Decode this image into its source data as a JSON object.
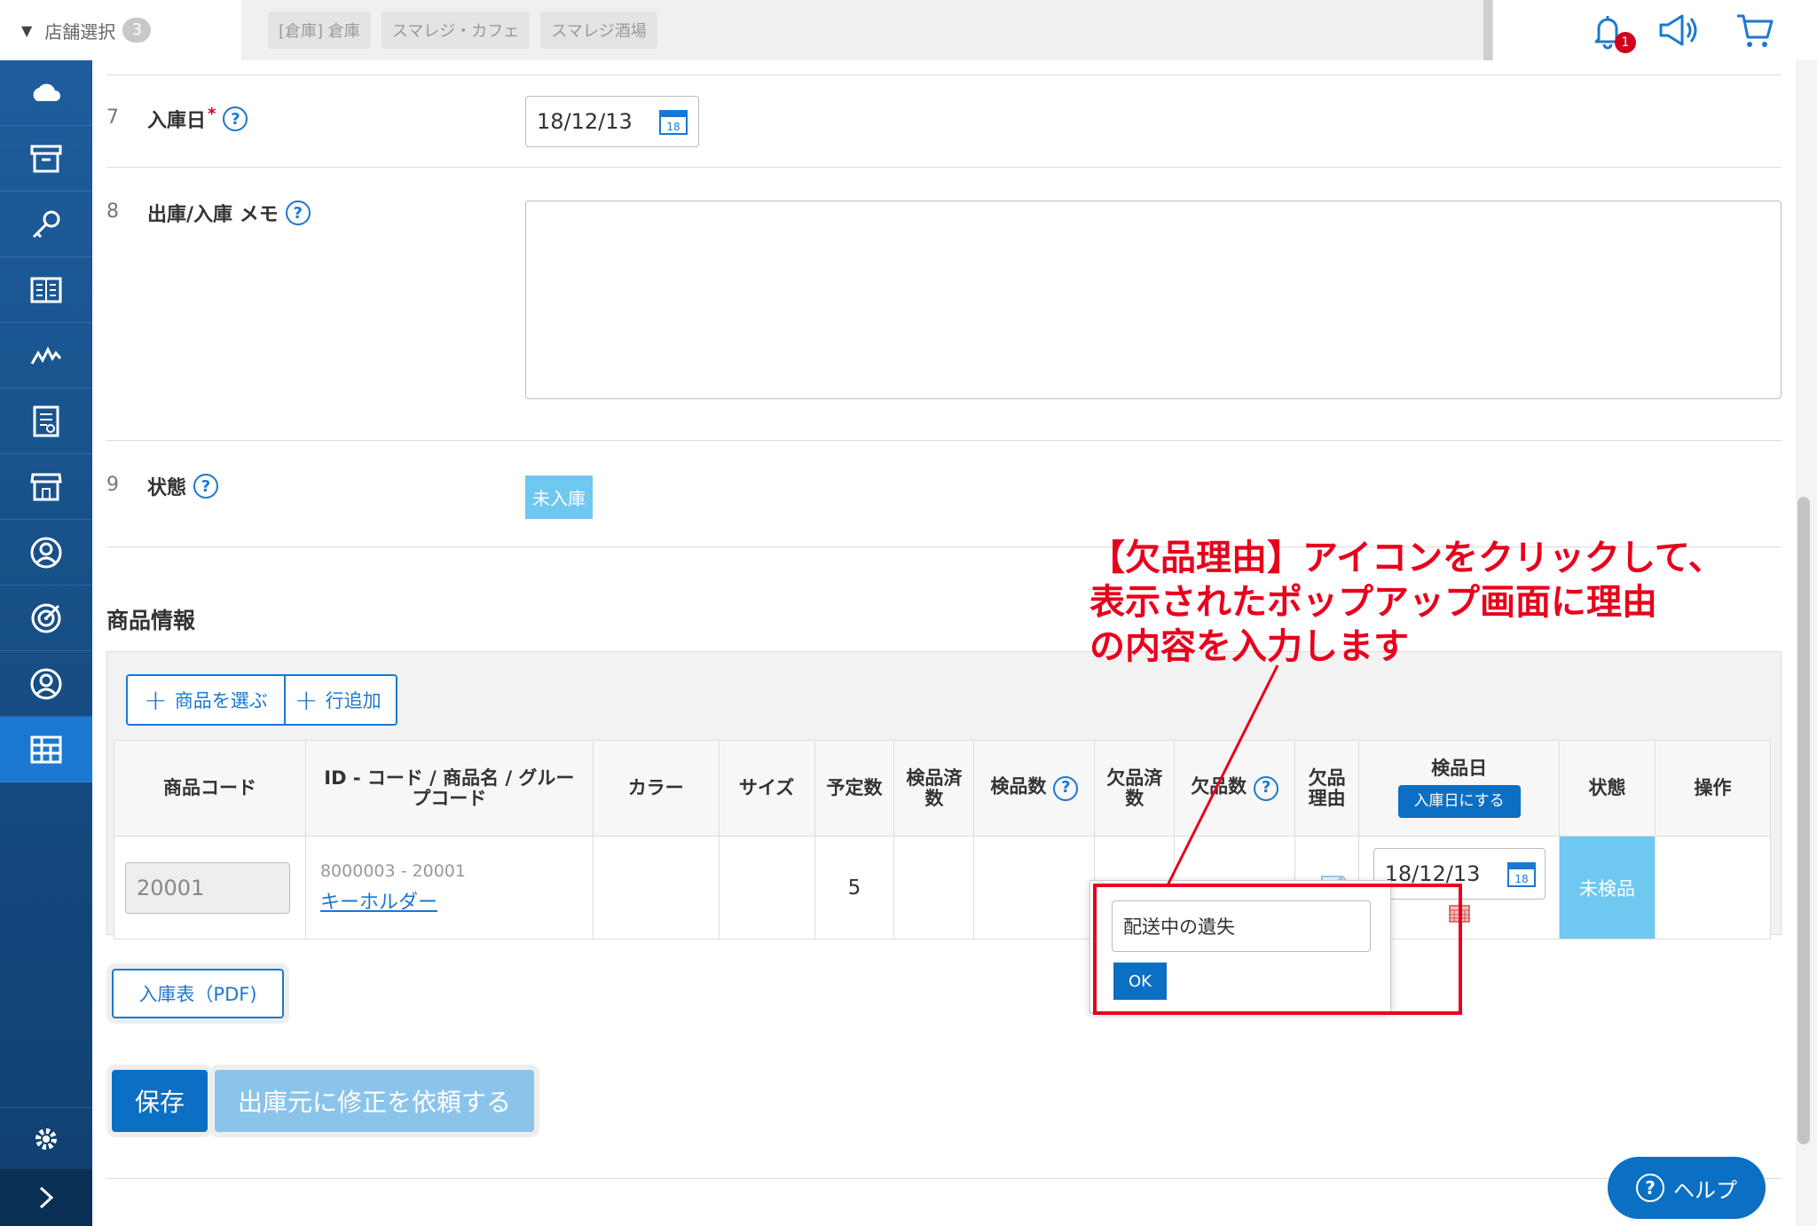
{
  "topbar": {
    "store_select_label": "店舗選択",
    "store_count": "3",
    "store_tabs": [
      "[倉庫] 倉庫",
      "スマレジ・カフェ",
      "スマレジ酒場"
    ],
    "notification_count": "1"
  },
  "sidebar": {
    "icons": [
      "cloud-icon",
      "archive-box-icon",
      "key-icon",
      "book-icon",
      "chart-line-icon",
      "report-icon",
      "store-icon",
      "customer-icon",
      "target-icon",
      "staff-icon",
      "grid-icon"
    ]
  },
  "form": {
    "row7": {
      "num": "7",
      "label": "入庫日",
      "required": "*",
      "date": "18/12/13",
      "cal_day": "18"
    },
    "row8": {
      "num": "8",
      "label": "出庫/入庫 メモ"
    },
    "row9": {
      "num": "9",
      "label": "状態",
      "status": "未入庫"
    }
  },
  "products": {
    "section_title": "商品情報",
    "select_button": "商品を選ぶ",
    "add_row_button": "行追加",
    "columns": [
      "商品コード",
      "ID - コード / 商品名 / グループコード",
      "カラー",
      "サイズ",
      "予定数",
      "検品済数",
      "検品数",
      "欠品済数",
      "欠品数",
      "欠品理由",
      "検品日",
      "状態",
      "操作"
    ],
    "set_date_button": "入庫日にする",
    "row": {
      "code": "20001",
      "id_code": "8000003 - 20001",
      "name": "キーホルダー",
      "color": "",
      "size": "",
      "planned": "5",
      "inspect_date": "18/12/13",
      "status": "未検品"
    }
  },
  "popup": {
    "reason_value": "配送中の遺失",
    "ok_label": "OK"
  },
  "annotation": {
    "line1": "【欠品理由】アイコンをクリックして、",
    "line2": "表示されたポップアップ画面に理由",
    "line3": "の内容を入力します"
  },
  "buttons": {
    "pdf": "入庫表（PDF)",
    "save": "保存",
    "request": "出庫元に修正を依頼する",
    "help": "ヘルプ"
  }
}
